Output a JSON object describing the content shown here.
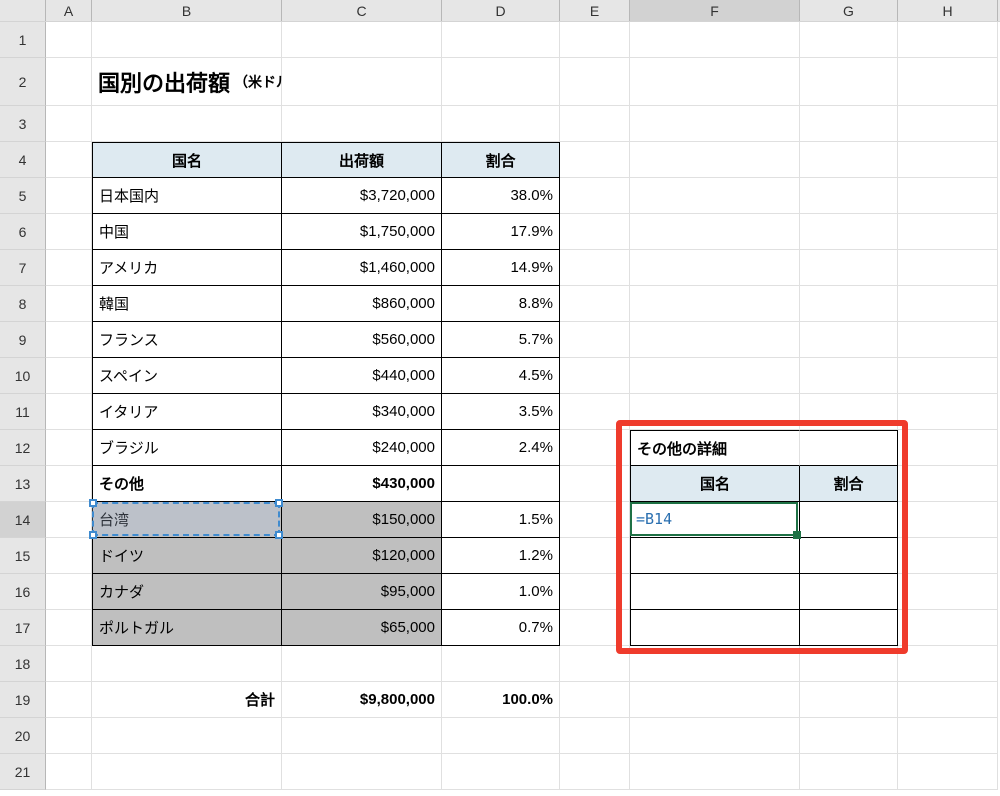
{
  "columns": [
    "A",
    "B",
    "C",
    "D",
    "E",
    "F",
    "G",
    "H"
  ],
  "colWidths": {
    "A": 46,
    "B": 190,
    "C": 160,
    "D": 118,
    "E": 70,
    "F": 170,
    "G": 98,
    "H": 100
  },
  "title": {
    "main": "国別の出荷額",
    "sub": "（米ドル換算）"
  },
  "mainTable": {
    "headers": {
      "country": "国名",
      "amount": "出荷額",
      "ratio": "割合"
    },
    "rows": [
      {
        "country": "日本国内",
        "amount": "$3,720,000",
        "ratio": "38.0%"
      },
      {
        "country": "中国",
        "amount": "$1,750,000",
        "ratio": "17.9%"
      },
      {
        "country": "アメリカ",
        "amount": "$1,460,000",
        "ratio": "14.9%"
      },
      {
        "country": "韓国",
        "amount": "$860,000",
        "ratio": "8.8%"
      },
      {
        "country": "フランス",
        "amount": "$560,000",
        "ratio": "5.7%"
      },
      {
        "country": "スペイン",
        "amount": "$440,000",
        "ratio": "4.5%"
      },
      {
        "country": "イタリア",
        "amount": "$340,000",
        "ratio": "3.5%"
      },
      {
        "country": "ブラジル",
        "amount": "$240,000",
        "ratio": "2.4%"
      }
    ],
    "other": {
      "label": "その他",
      "amount": "$430,000"
    },
    "detail": [
      {
        "country": "台湾",
        "amount": "$150,000",
        "ratio": "1.5%"
      },
      {
        "country": "ドイツ",
        "amount": "$120,000",
        "ratio": "1.2%"
      },
      {
        "country": "カナダ",
        "amount": "$95,000",
        "ratio": "1.0%"
      },
      {
        "country": "ポルトガル",
        "amount": "$65,000",
        "ratio": "0.7%"
      }
    ],
    "total": {
      "label": "合計",
      "amount": "$9,800,000",
      "ratio": "100.0%"
    }
  },
  "sideTable": {
    "title": "その他の詳細",
    "headers": {
      "country": "国名",
      "ratio": "割合"
    }
  },
  "editing": {
    "cell": "F14",
    "formula": "=B14",
    "refCell": "B14"
  },
  "activeColumn": "F",
  "activeRow": 14,
  "rowCount": 21
}
